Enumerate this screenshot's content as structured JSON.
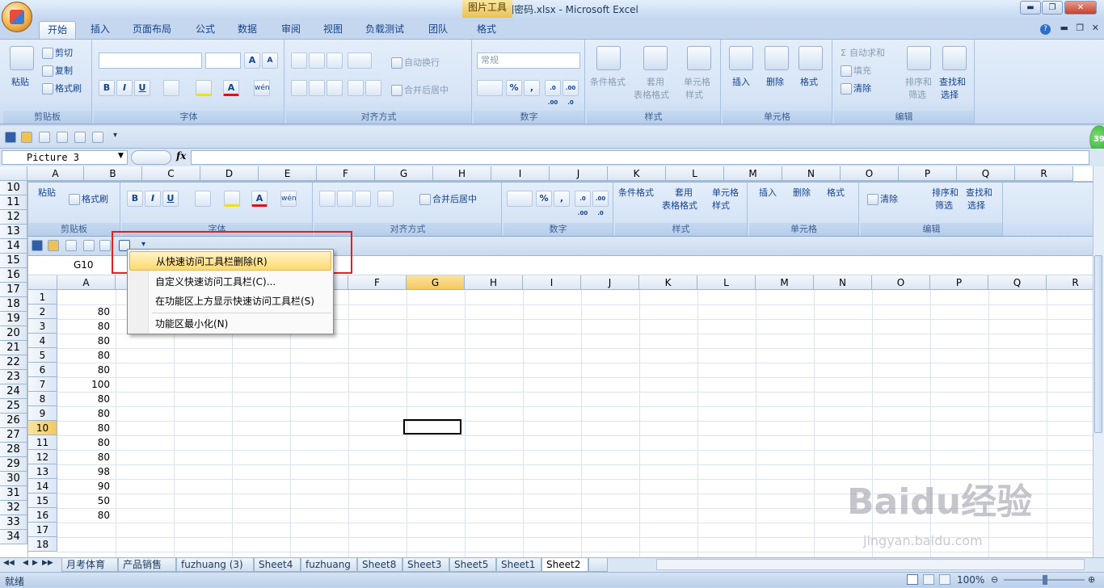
{
  "window": {
    "title": "两小无猜网密码.xlsx - Microsoft Excel",
    "context_tab": "图片工具",
    "buttons": {
      "minimize": "▬",
      "restore": "❐",
      "close": "✕"
    }
  },
  "ribbon_tabs": [
    "开始",
    "插入",
    "页面布局",
    "公式",
    "数据",
    "审阅",
    "视图",
    "负载测试",
    "团队",
    "格式"
  ],
  "ribbon": {
    "clipboard": {
      "paste": "粘贴",
      "cut": "剪切",
      "copy": "复制",
      "format_painter": "格式刷",
      "name": "剪贴板"
    },
    "font": {
      "name": "字体",
      "bold": "B",
      "italic": "I",
      "underline": "U",
      "grow": "A",
      "shrink": "A",
      "wen": "wén"
    },
    "alignment": {
      "wrap": "自动换行",
      "merge": "合并后居中",
      "name": "对齐方式"
    },
    "number": {
      "format": "常规",
      "percent": "%",
      "comma": ",",
      "inc": ".0 .00",
      "dec": ".00 .0",
      "name": "数字"
    },
    "styles": {
      "conditional": "条件格式",
      "table_1": "套用",
      "table_2": "表格格式",
      "cell_1": "单元格",
      "cell_2": "样式",
      "name": "样式"
    },
    "cells": {
      "insert": "插入",
      "delete": "删除",
      "format": "格式",
      "name": "单元格"
    },
    "editing": {
      "autosum": "自动求和",
      "fill": "填充",
      "clear": "清除",
      "sort_1": "排序和",
      "sort_2": "筛选",
      "find_1": "查找和",
      "find_2": "选择",
      "name": "编辑",
      "sigma": "Σ"
    }
  },
  "namebox": {
    "value": "Picture 3"
  },
  "formula_fx": "fx",
  "columns": [
    "A",
    "B",
    "C",
    "D",
    "E",
    "F",
    "G",
    "H",
    "I",
    "J",
    "K",
    "L",
    "M",
    "N",
    "O",
    "P",
    "Q",
    "R"
  ],
  "row_numbers": [
    "10",
    "11",
    "12",
    "13",
    "14",
    "15",
    "16",
    "17",
    "18",
    "19",
    "20",
    "21",
    "22",
    "23",
    "24",
    "25",
    "26",
    "27",
    "28",
    "29",
    "30",
    "31",
    "32",
    "33",
    "34"
  ],
  "picture": {
    "ribbon": {
      "paste": "粘贴",
      "format_painter": "格式刷",
      "clipboard": "剪贴板",
      "font": "字体",
      "merge": "合并后居中",
      "alignment": "对齐方式",
      "number": "数字",
      "cond": "条件格式",
      "table_1": "套用",
      "table_2": "表格格式",
      "cell_style_1": "单元格",
      "cell_style_2": "样式",
      "styles": "样式",
      "insert": "插入",
      "delete": "删除",
      "format": "格式",
      "cells": "单元格",
      "clear": "清除",
      "sort_1": "排序和",
      "sort_2": "筛选",
      "find_1": "查找和",
      "find_2": "选择",
      "editing": "编辑"
    },
    "namebox": "G10",
    "columns": [
      "A",
      "B",
      "C",
      "D",
      "E",
      "F",
      "G",
      "H",
      "I",
      "J",
      "K",
      "L",
      "M",
      "N",
      "O",
      "P",
      "Q",
      "R"
    ],
    "rows": [
      {
        "num": "1",
        "a": ""
      },
      {
        "num": "2",
        "a": "80"
      },
      {
        "num": "3",
        "a": "80"
      },
      {
        "num": "4",
        "a": "80"
      },
      {
        "num": "5",
        "a": "80"
      },
      {
        "num": "6",
        "a": "80"
      },
      {
        "num": "7",
        "a": "100"
      },
      {
        "num": "8",
        "a": "80"
      },
      {
        "num": "9",
        "a": "80"
      },
      {
        "num": "10",
        "a": "80"
      },
      {
        "num": "11",
        "a": "80"
      },
      {
        "num": "12",
        "a": "80"
      },
      {
        "num": "13",
        "a": "98"
      },
      {
        "num": "14",
        "a": "90"
      },
      {
        "num": "15",
        "a": "50"
      },
      {
        "num": "16",
        "a": "80"
      },
      {
        "num": "17",
        "a": ""
      },
      {
        "num": "18",
        "a": ""
      }
    ]
  },
  "context_menu": [
    {
      "label": "从快速访问工具栏删除(R)",
      "highlight": true
    },
    {
      "label": "自定义快速访问工具栏(C)...",
      "highlight": false
    },
    {
      "label": "在功能区上方显示快速访问工具栏(S)",
      "highlight": false
    },
    {
      "label": "功能区最小化(N)",
      "highlight": false
    }
  ],
  "sheet_tabs": [
    "月考体育",
    "产品销售",
    "fuzhuang (3)",
    "Sheet4",
    "fuzhuang",
    "Sheet8",
    "Sheet3",
    "Sheet5",
    "Sheet1",
    "Sheet2"
  ],
  "active_sheet": "Sheet2",
  "status": {
    "ready": "就绪",
    "zoom": "100%"
  },
  "badge": "39",
  "watermark": {
    "brand": "Baidu经验",
    "url": "jingyan.baidu.com"
  }
}
